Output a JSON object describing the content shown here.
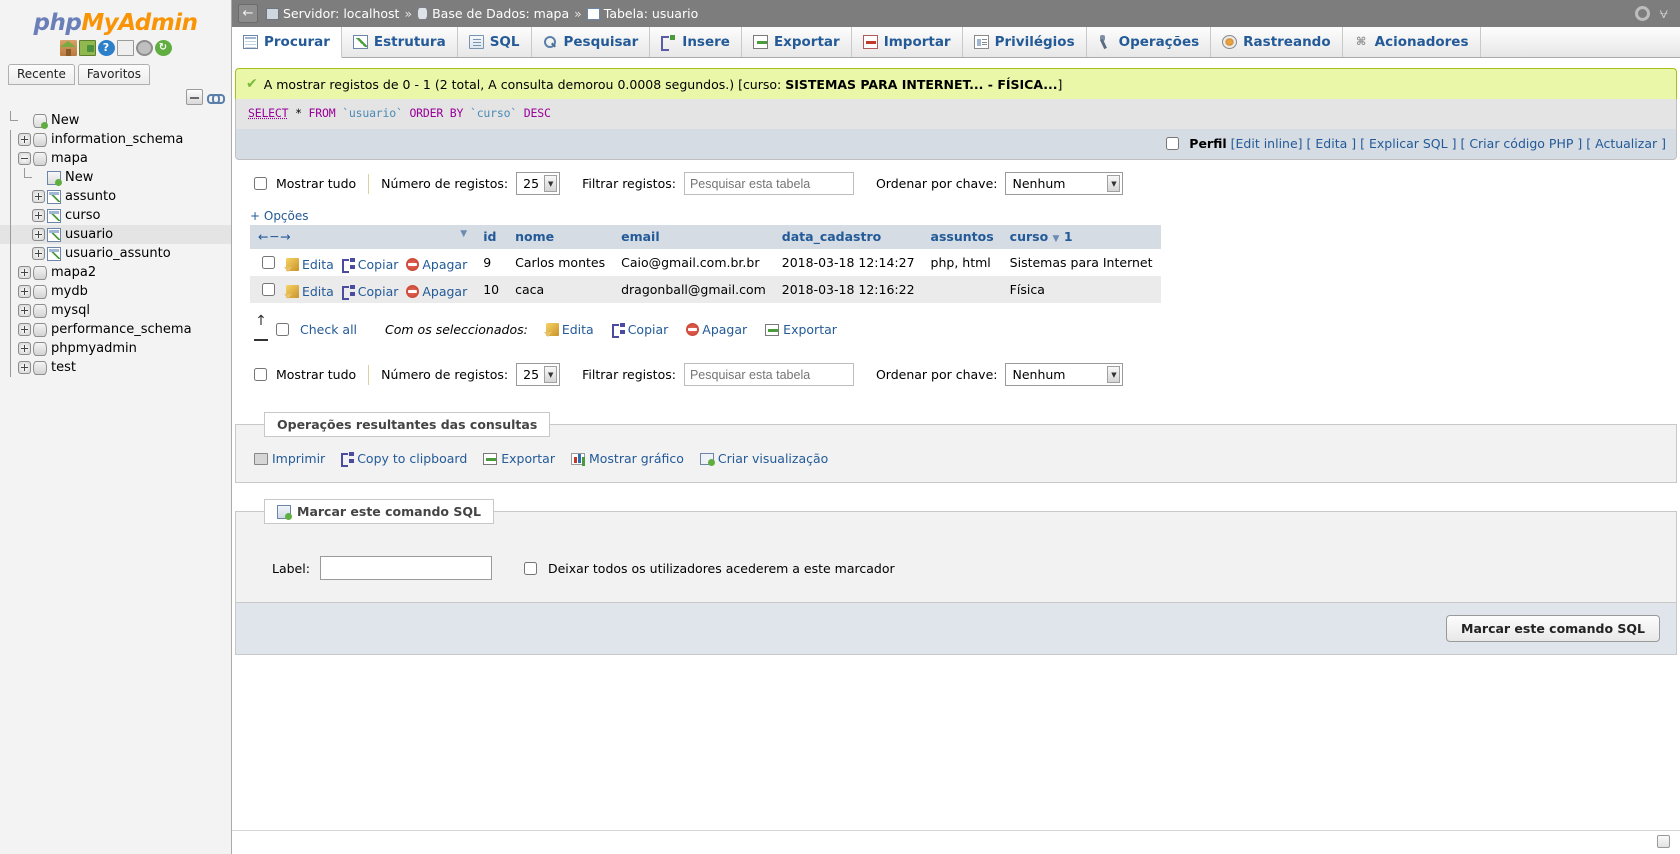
{
  "app": {
    "logo_php": "php",
    "logo_my": "My",
    "logo_admin": "Admin"
  },
  "sidebar": {
    "icons": [
      "home-icon",
      "exit-icon",
      "help-icon",
      "docs-icon",
      "settings-icon",
      "refresh-icon"
    ],
    "help_glyph": "?",
    "refresh_glyph": "↻",
    "tabs": [
      {
        "label": "Recente"
      },
      {
        "label": "Favoritos"
      }
    ],
    "tree": [
      {
        "label": "New",
        "level": 0,
        "type": "new-db",
        "toggle": "none"
      },
      {
        "label": "information_schema",
        "level": 0,
        "type": "db",
        "toggle": "plus"
      },
      {
        "label": "mapa",
        "level": 0,
        "type": "db",
        "toggle": "minus",
        "selected": false
      },
      {
        "label": "New",
        "level": 1,
        "type": "new-table",
        "toggle": "none"
      },
      {
        "label": "assunto",
        "level": 1,
        "type": "table",
        "toggle": "plus"
      },
      {
        "label": "curso",
        "level": 1,
        "type": "table",
        "toggle": "plus"
      },
      {
        "label": "usuario",
        "level": 1,
        "type": "table",
        "toggle": "plus",
        "selected": true
      },
      {
        "label": "usuario_assunto",
        "level": 1,
        "type": "table",
        "toggle": "plus"
      },
      {
        "label": "mapa2",
        "level": 0,
        "type": "db",
        "toggle": "plus"
      },
      {
        "label": "mydb",
        "level": 0,
        "type": "db",
        "toggle": "plus"
      },
      {
        "label": "mysql",
        "level": 0,
        "type": "db",
        "toggle": "plus"
      },
      {
        "label": "performance_schema",
        "level": 0,
        "type": "db",
        "toggle": "plus"
      },
      {
        "label": "phpmyadmin",
        "level": 0,
        "type": "db",
        "toggle": "plus"
      },
      {
        "label": "test",
        "level": 0,
        "type": "db",
        "toggle": "plus"
      }
    ]
  },
  "topbar": {
    "back_glyph": "←",
    "server_label": "Servidor: localhost",
    "database_label": "Base de Dados: mapa",
    "table_label": "Tabela: usuario",
    "separator": "»",
    "collapse_glyph": "⩝"
  },
  "navtabs": [
    {
      "label": "Procurar",
      "icon": "browse-icon",
      "active": true
    },
    {
      "label": "Estrutura",
      "icon": "structure-icon",
      "active": false
    },
    {
      "label": "SQL",
      "icon": "sql-icon",
      "active": false
    },
    {
      "label": "Pesquisar",
      "icon": "search-icon",
      "active": false
    },
    {
      "label": "Insere",
      "icon": "insert-icon",
      "active": false
    },
    {
      "label": "Exportar",
      "icon": "export-icon",
      "active": false
    },
    {
      "label": "Importar",
      "icon": "import-icon",
      "active": false
    },
    {
      "label": "Privilégios",
      "icon": "privileges-icon",
      "active": false
    },
    {
      "label": "Operações",
      "icon": "operations-icon",
      "active": false
    },
    {
      "label": "Rastreando",
      "icon": "tracking-icon",
      "active": false
    },
    {
      "label": "Acionadores",
      "icon": "triggers-icon",
      "active": false
    }
  ],
  "notice": {
    "check_glyph": "✔",
    "text_plain": "A mostrar registos de 0 - 1 (2 total, A consulta demorou 0.0008 segundos.) [curso: ",
    "text_bold": "SISTEMAS PARA INTERNET... - FÍSICA...",
    "text_tail": "]"
  },
  "sql": {
    "kw_select": "SELECT",
    "star": "*",
    "kw_from": "FROM",
    "tbl": "`usuario`",
    "kw_order": "ORDER BY",
    "col": "`curso`",
    "kw_desc": "DESC"
  },
  "linkbar": {
    "profile_label": "Perfil",
    "edit_inline": "Edit inline",
    "edit": "Edita",
    "explain": "Explicar SQL",
    "create_php": "Criar código PHP",
    "refresh": "Actualizar",
    "bracket_open": "[",
    "bracket_close": "]"
  },
  "controls": {
    "show_all": "Mostrar tudo",
    "num_rows_label": "Número de registos:",
    "num_rows_value": "25",
    "filter_label": "Filtrar registos:",
    "filter_placeholder": "Pesquisar esta tabela",
    "sort_label": "Ordenar por chave:",
    "sort_value": "Nenhum"
  },
  "options_toggle": "+ Opções",
  "table": {
    "nav_arrows": "← ─ →",
    "sort_caret": "▼",
    "columns": [
      {
        "label": "id"
      },
      {
        "label": "nome"
      },
      {
        "label": "email"
      },
      {
        "label": "data_cadastro"
      },
      {
        "label": "assuntos"
      },
      {
        "label": "curso",
        "sorted": true,
        "sort_dir": "▼",
        "sort_index": "1"
      }
    ],
    "actions": {
      "edit": "Edita",
      "copy": "Copiar",
      "delete": "Apagar"
    },
    "rows": [
      {
        "id": "9",
        "nome": "Carlos montes",
        "email": "Caio@gmail.com.br.br",
        "data_cadastro": "2018-03-18 12:14:27",
        "assuntos": "php, html",
        "curso": "Sistemas para Internet"
      },
      {
        "id": "10",
        "nome": "caca",
        "email": "dragonball@gmail.com",
        "data_cadastro": "2018-03-18 12:16:22",
        "assuntos": "",
        "curso": "Física"
      }
    ]
  },
  "checkall": {
    "arrow_glyph": "↑",
    "label": "Check all",
    "with_selected": "Com os seleccionados:",
    "actions": [
      {
        "label": "Edita",
        "icon": "pencil-icon"
      },
      {
        "label": "Copiar",
        "icon": "copy-icon"
      },
      {
        "label": "Apagar",
        "icon": "delete-icon"
      },
      {
        "label": "Exportar",
        "icon": "export-icon"
      }
    ]
  },
  "query_results": {
    "legend": "Operações resultantes das consultas",
    "links": [
      {
        "label": "Imprimir",
        "icon": "print-icon"
      },
      {
        "label": "Copy to clipboard",
        "icon": "copy-icon"
      },
      {
        "label": "Exportar",
        "icon": "export-icon"
      },
      {
        "label": "Mostrar gráfico",
        "icon": "chart-icon"
      },
      {
        "label": "Criar visualização",
        "icon": "view-icon"
      }
    ]
  },
  "bookmark": {
    "legend": "Marcar este comando SQL",
    "legend_icon": "bookmark-icon",
    "label_text": "Label:",
    "label_value": "",
    "share_checkbox": "Deixar todos os utilizadores acederem a este marcador",
    "submit_button": "Marcar este comando SQL"
  }
}
